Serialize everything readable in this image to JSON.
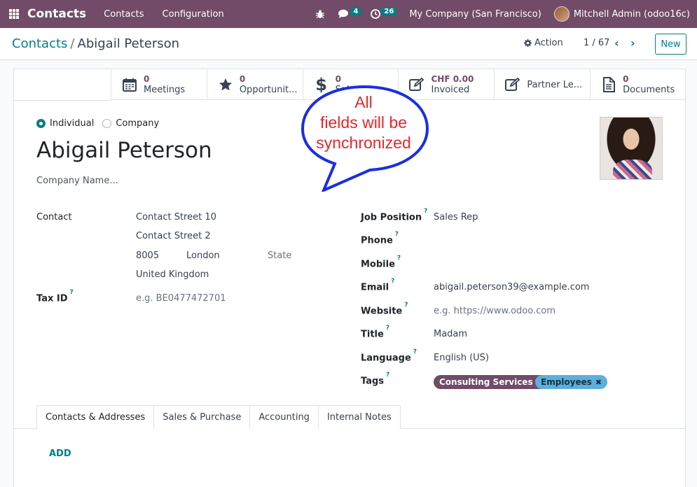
{
  "topbar": {
    "app_name": "Contacts",
    "menu": [
      "Contacts",
      "Configuration"
    ],
    "chat_count": "4",
    "activity_count": "26",
    "company": "My Company (San Francisco)",
    "user": "Mitchell Admin (odoo16c)",
    "icons": [
      "apps-icon",
      "bug-icon",
      "chat-icon",
      "clock-icon",
      "user-avatar"
    ]
  },
  "control": {
    "breadcrumb_parent": "Contacts",
    "breadcrumb_current": "Abigail Peterson",
    "action_label": "Action",
    "pager": "1 / 67",
    "new_label": "New"
  },
  "smart_buttons": [
    {
      "value": "0",
      "label": "Meetings",
      "icon": "calendar-icon"
    },
    {
      "value": "0",
      "label": "Opportunit...",
      "icon": "star-icon"
    },
    {
      "value": "0",
      "label": "Sales",
      "icon": "dollar-icon"
    },
    {
      "value": "CHF 0.00",
      "label": "Invoiced",
      "icon": "edit-icon"
    },
    {
      "value": "",
      "label": "Partner Le...",
      "icon": "edit-icon"
    },
    {
      "value": "0",
      "label": "Documents",
      "icon": "document-icon"
    }
  ],
  "form": {
    "type_individual": "Individual",
    "type_company": "Company",
    "name": "Abigail Peterson",
    "company_placeholder": "Company Name...",
    "contact_label": "Contact",
    "street": "Contact Street 10",
    "street2": "Contact Street 2",
    "zip": "8005",
    "city": "London",
    "state_placeholder": "State",
    "country": "United Kingdom",
    "tax_label": "Tax ID",
    "tax_placeholder": "e.g. BE0477472701",
    "job_label": "Job Position",
    "job_value": "Sales Rep",
    "phone_label": "Phone",
    "mobile_label": "Mobile",
    "email_label": "Email",
    "email_value": "abigail.peterson39@example.com",
    "website_label": "Website",
    "website_placeholder": "e.g. https://www.odoo.com",
    "title_label": "Title",
    "title_value": "Madam",
    "language_label": "Language",
    "language_value": "English (US)",
    "tags_label": "Tags",
    "help_mark": "?",
    "tags": [
      {
        "label": "Consulting Services",
        "color": "#714b67",
        "text_color": "#ffffff"
      },
      {
        "label": "Employees",
        "color": "#5bb0dd",
        "text_color": "#1f2d3d"
      }
    ]
  },
  "tabs": [
    "Contacts & Addresses",
    "Sales & Purchase",
    "Accounting",
    "Internal Notes"
  ],
  "add_label": "ADD",
  "callout": {
    "lines": [
      "All",
      "fields will be",
      "synchronized"
    ],
    "color": "#e8262b",
    "border_color": "#1a2ee0"
  },
  "colors": {
    "brand": "#714b67",
    "accent": "#017e84"
  }
}
